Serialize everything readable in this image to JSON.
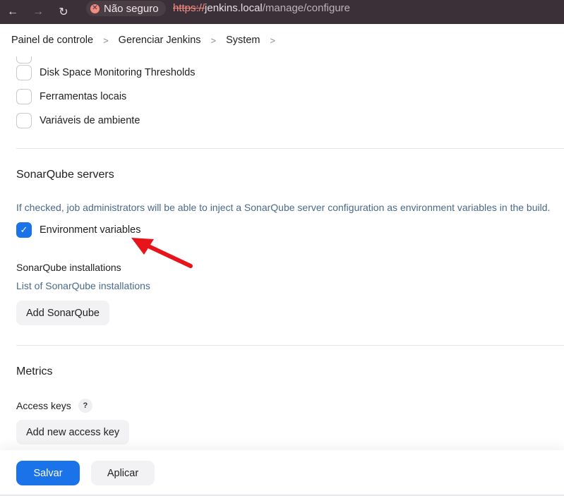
{
  "browser": {
    "back_icon": "←",
    "forward_icon": "→",
    "reload_icon": "↻",
    "security_label": "Não seguro",
    "url_scheme": "https://",
    "url_host": "jenkins.local",
    "url_path": "/manage/configure"
  },
  "breadcrumb": {
    "items": [
      "Painel de controle",
      "Gerenciar Jenkins",
      "System"
    ],
    "separator": ">"
  },
  "global_props": {
    "items": [
      {
        "label": "Disk Space Monitoring Thresholds",
        "checked": false
      },
      {
        "label": "Ferramentas locais",
        "checked": false
      },
      {
        "label": "Variáveis de ambiente",
        "checked": false
      }
    ]
  },
  "sonarqube": {
    "title": "SonarQube servers",
    "help": "If checked, job administrators will be able to inject a SonarQube server configuration as environment variables in the build.",
    "env_vars_label": "Environment variables",
    "env_vars_checked": true,
    "installations_label": "SonarQube installations",
    "installations_help": "List of SonarQube installations",
    "add_button": "Add SonarQube"
  },
  "metrics": {
    "title": "Metrics",
    "access_keys_label": "Access keys",
    "help_icon": "?",
    "add_button": "Add new access key"
  },
  "footer": {
    "save": "Salvar",
    "apply": "Aplicar"
  },
  "colors": {
    "accent": "#1a73e8",
    "annotation": "#e8141b",
    "browser_bar": "#3c3038"
  }
}
